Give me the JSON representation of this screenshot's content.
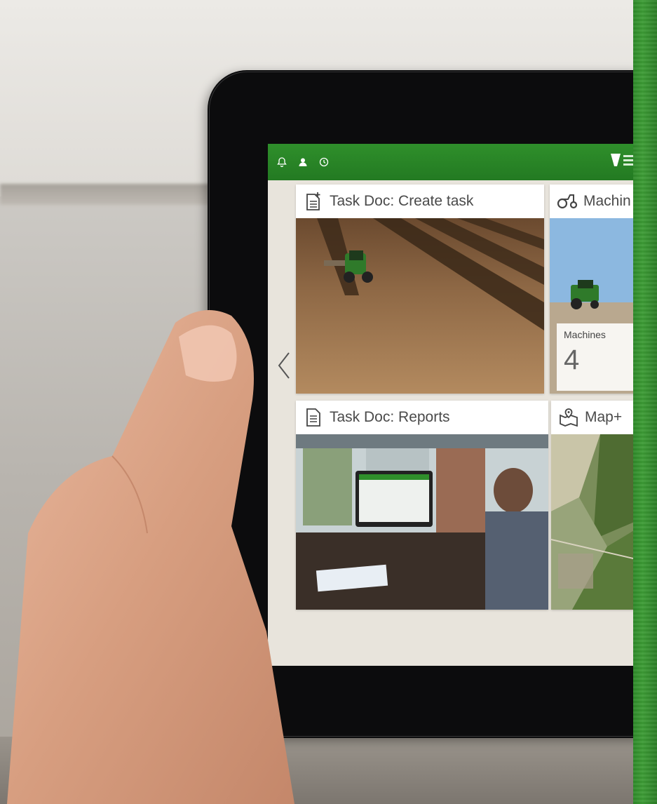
{
  "topbar": {
    "icons": [
      "bell-icon",
      "user-icon",
      "clock-icon"
    ],
    "brand_color": "#2a8a27"
  },
  "navigation": {
    "back_icon": "chevron-left-icon"
  },
  "tiles": [
    {
      "id": "task-doc-create",
      "title": "Task Doc: Create task",
      "icon": "document-add-icon"
    },
    {
      "id": "machines",
      "title": "Machin",
      "icon": "tractor-icon",
      "overlay_label": "Machines",
      "overlay_value": "4"
    },
    {
      "id": "task-doc-reports",
      "title": "Task Doc: Reports",
      "icon": "document-icon"
    },
    {
      "id": "map-plus",
      "title": "Map+",
      "icon": "map-pin-icon"
    }
  ],
  "colors": {
    "screen_bg": "#e8e4dc",
    "accent_green": "#2f8f2b",
    "tile_text": "#4a4a4a"
  }
}
